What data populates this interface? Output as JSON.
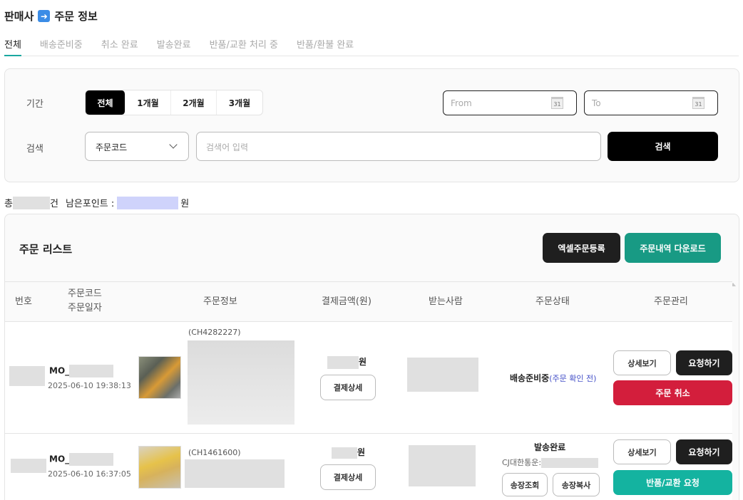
{
  "header": {
    "seller": "판매사",
    "arrow_icon": "right-arrow-icon",
    "page": "주문 정보"
  },
  "tabs": [
    "전체",
    "배송준비중",
    "취소 완료",
    "발송완료",
    "반품/교환 처리 중",
    "반품/환불 완료"
  ],
  "filter": {
    "period_label": "기간",
    "period_options": [
      "전체",
      "1개월",
      "2개월",
      "3개월"
    ],
    "from_placeholder": "From",
    "to_placeholder": "To",
    "calendar_glyph": "31",
    "search_label": "검색",
    "search_type": "주문코드",
    "search_placeholder": "검색어 입력",
    "search_button": "검색"
  },
  "summary": {
    "total_prefix": "총",
    "total_suffix": "건",
    "points_label": "남은포인트 :",
    "points_suffix": "원"
  },
  "list": {
    "title": "주문 리스트",
    "excel_button": "엑셀주문등록",
    "download_button": "주문내역 다운로드",
    "columns": {
      "no": "번호",
      "code": "주문코드",
      "date": "주문일자",
      "info": "주문정보",
      "amount": "결제금액(원)",
      "receiver": "받는사람",
      "status": "주문상태",
      "manage": "주문관리"
    },
    "rows": [
      {
        "order_code": "MO_",
        "order_date": "2025-06-10 19:38:13",
        "product_code": "(CH4282227)",
        "amount_suffix": "원",
        "payment_detail": "결제상세",
        "status": "배송준비중",
        "status_sub": "(주문 확인 전)",
        "detail_button": "상세보기",
        "request_button": "요청하기",
        "cancel_button": "주문 취소"
      },
      {
        "order_code": "MO_",
        "order_date": "2025-06-10 16:37:05",
        "product_code": "(CH1461600)",
        "amount_suffix": "원",
        "payment_detail": "결제상세",
        "status": "발송완료",
        "carrier": "CJ대한통운:",
        "track_button": "송장조회",
        "copy_button": "송장복사",
        "detail_button": "상세보기",
        "request_button": "요청하기",
        "return_button": "반품/교환 요청"
      }
    ]
  },
  "colors": {
    "accent_teal": "#189a84",
    "cancel_red": "#d31e3c",
    "return_green": "#14b3a0",
    "status_blue": "#4551c8"
  }
}
